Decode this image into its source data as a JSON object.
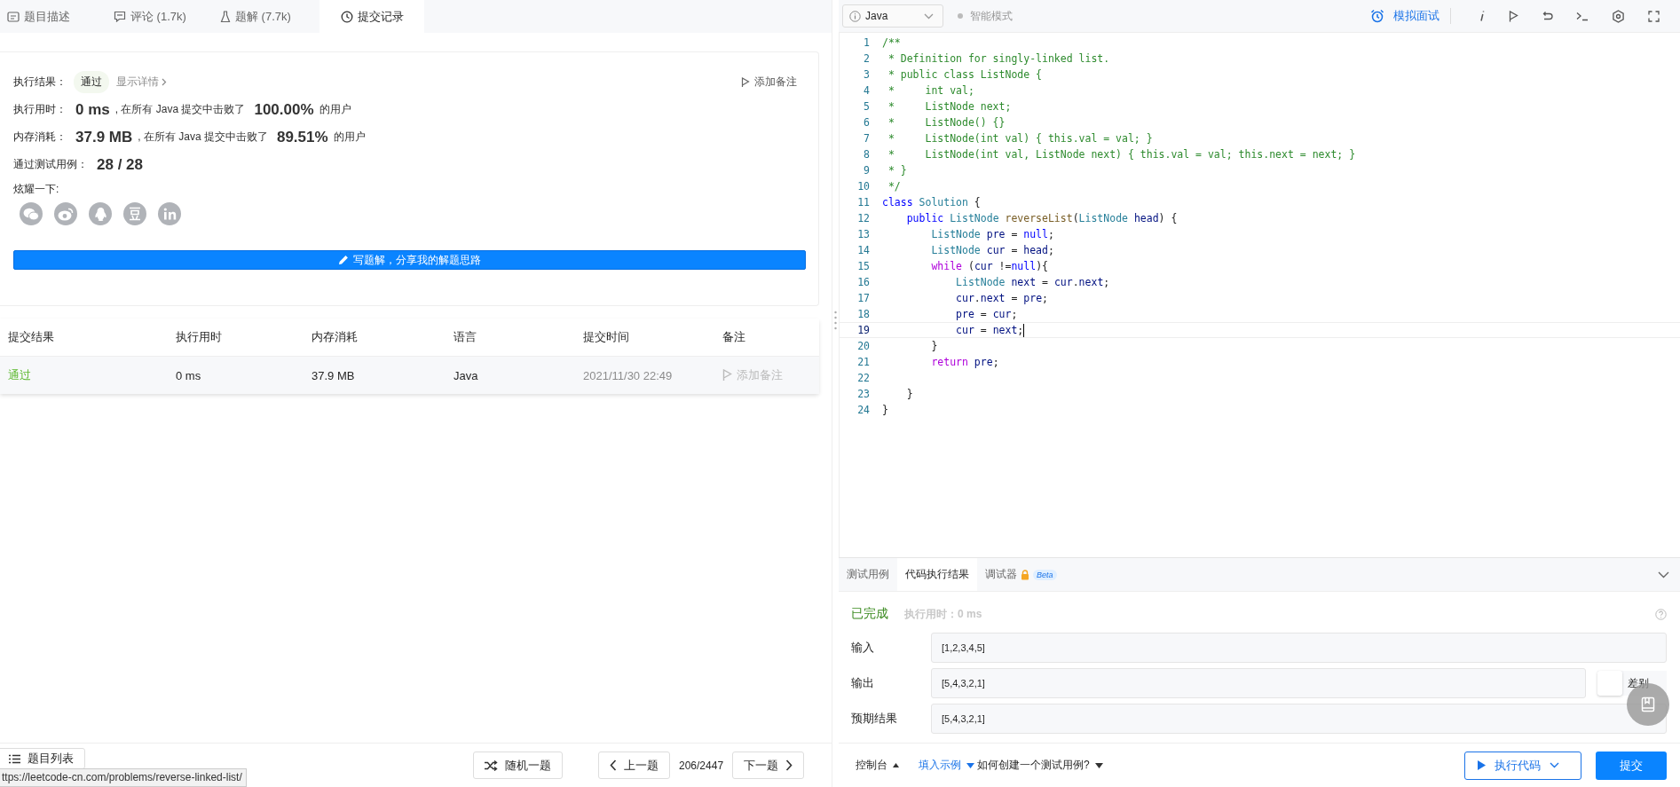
{
  "tabs": [
    {
      "label": "题目描述",
      "kind": "description",
      "selected": false
    },
    {
      "label": "评论 (1.7k)",
      "kind": "comments",
      "selected": false
    },
    {
      "label": "题解 (7.7k)",
      "kind": "solutions",
      "selected": false
    },
    {
      "label": "提交记录",
      "kind": "submissions",
      "selected": true
    }
  ],
  "result_card": {
    "status_label": "执行结果：",
    "status": "通过",
    "details_link": "显示详情",
    "add_note": "添加备注",
    "stats": [
      {
        "label": "执行用时：",
        "value": "0 ms",
        "text_before": ", 在所有 Java 提交中击败了",
        "percent": "100.00%",
        "text_after": "的用户"
      },
      {
        "label": "内存消耗：",
        "value": "37.9 MB",
        "text_before": ", 在所有 Java 提交中击败了",
        "percent": "89.51%",
        "text_after": "的用户"
      }
    ],
    "tests": {
      "label": "通过测试用例：",
      "value": "28 / 28"
    },
    "share_label": "炫耀一下:",
    "share": [
      {
        "kind": "wechat"
      },
      {
        "kind": "weibo"
      },
      {
        "kind": "qq"
      },
      {
        "kind": "douban"
      },
      {
        "kind": "linkedin"
      }
    ],
    "write_button": "写题解，分享我的解题思路"
  },
  "submissions": {
    "columns": [
      "提交结果",
      "执行用时",
      "内存消耗",
      "语言",
      "提交时间",
      "备注"
    ],
    "rows": [
      {
        "status": "通过",
        "runtime": "0 ms",
        "memory": "37.9 MB",
        "language": "Java",
        "time": "2021/11/30 22:49",
        "note": "添加备注"
      }
    ]
  },
  "editor": {
    "language": "Java",
    "mode": "智能模式",
    "mock_interview": "模拟面试",
    "lines": [
      {
        "number": "1",
        "current": false,
        "tokens": [
          {
            "kind": "comment",
            "t": "/**"
          }
        ]
      },
      {
        "number": "2",
        "current": false,
        "tokens": [
          {
            "kind": "comment",
            "t": " * Definition for singly-linked list."
          }
        ]
      },
      {
        "number": "3",
        "current": false,
        "tokens": [
          {
            "kind": "comment",
            "t": " * public class ListNode {"
          }
        ]
      },
      {
        "number": "4",
        "current": false,
        "tokens": [
          {
            "kind": "comment",
            "t": " *     int val;"
          }
        ]
      },
      {
        "number": "5",
        "current": false,
        "tokens": [
          {
            "kind": "comment",
            "t": " *     ListNode next;"
          }
        ]
      },
      {
        "number": "6",
        "current": false,
        "tokens": [
          {
            "kind": "comment",
            "t": " *     ListNode() {}"
          }
        ]
      },
      {
        "number": "7",
        "current": false,
        "tokens": [
          {
            "kind": "comment",
            "t": " *     ListNode(int val) { this.val = val; }"
          }
        ]
      },
      {
        "number": "8",
        "current": false,
        "tokens": [
          {
            "kind": "comment",
            "t": " *     ListNode(int val, ListNode next) { this.val = val; this.next = next; }"
          }
        ]
      },
      {
        "number": "9",
        "current": false,
        "tokens": [
          {
            "kind": "comment",
            "t": " * }"
          }
        ]
      },
      {
        "number": "10",
        "current": false,
        "tokens": [
          {
            "kind": "comment",
            "t": " */"
          }
        ]
      },
      {
        "number": "11",
        "current": false,
        "tokens": [
          {
            "kind": "keyword",
            "t": "class"
          },
          {
            "kind": "type",
            "t": " Solution"
          },
          {
            "kind": "text",
            "t": " {"
          }
        ]
      },
      {
        "number": "12",
        "current": false,
        "tokens": [
          {
            "kind": "keyword",
            "t": "    public"
          },
          {
            "kind": "type",
            "t": " ListNode"
          },
          {
            "kind": "function",
            "t": " reverseList"
          },
          {
            "kind": "text",
            "t": "("
          },
          {
            "kind": "type",
            "t": "ListNode"
          },
          {
            "kind": "variable",
            "t": " head"
          },
          {
            "kind": "text",
            "t": ") {"
          }
        ]
      },
      {
        "number": "13",
        "current": false,
        "tokens": [
          {
            "kind": "type",
            "t": "        ListNode"
          },
          {
            "kind": "variable",
            "t": " pre"
          },
          {
            "kind": "text",
            "t": " = "
          },
          {
            "kind": "keyword",
            "t": "null"
          },
          {
            "kind": "text",
            "t": ";"
          }
        ]
      },
      {
        "number": "14",
        "current": false,
        "tokens": [
          {
            "kind": "type",
            "t": "        ListNode"
          },
          {
            "kind": "variable",
            "t": " cur"
          },
          {
            "kind": "text",
            "t": " = "
          },
          {
            "kind": "variable",
            "t": "head"
          },
          {
            "kind": "text",
            "t": ";"
          }
        ]
      },
      {
        "number": "15",
        "current": false,
        "tokens": [
          {
            "kind": "control",
            "t": "        while"
          },
          {
            "kind": "text",
            "t": " ("
          },
          {
            "kind": "variable",
            "t": "cur"
          },
          {
            "kind": "text",
            "t": " !="
          },
          {
            "kind": "keyword",
            "t": "null"
          },
          {
            "kind": "text",
            "t": "){"
          }
        ]
      },
      {
        "number": "16",
        "current": false,
        "tokens": [
          {
            "kind": "type",
            "t": "            ListNode"
          },
          {
            "kind": "variable",
            "t": " next"
          },
          {
            "kind": "text",
            "t": " = "
          },
          {
            "kind": "variable",
            "t": "cur"
          },
          {
            "kind": "text",
            "t": "."
          },
          {
            "kind": "variable",
            "t": "next"
          },
          {
            "kind": "text",
            "t": ";"
          }
        ]
      },
      {
        "number": "17",
        "current": false,
        "tokens": [
          {
            "kind": "variable",
            "t": "            cur"
          },
          {
            "kind": "text",
            "t": "."
          },
          {
            "kind": "variable",
            "t": "next"
          },
          {
            "kind": "text",
            "t": " = "
          },
          {
            "kind": "variable",
            "t": "pre"
          },
          {
            "kind": "text",
            "t": ";"
          }
        ]
      },
      {
        "number": "18",
        "current": false,
        "tokens": [
          {
            "kind": "variable",
            "t": "            pre"
          },
          {
            "kind": "text",
            "t": " = "
          },
          {
            "kind": "variable",
            "t": "cur"
          },
          {
            "kind": "text",
            "t": ";"
          }
        ]
      },
      {
        "number": "19",
        "current": true,
        "tokens": [
          {
            "kind": "variable",
            "t": "            cur"
          },
          {
            "kind": "text",
            "t": " = "
          },
          {
            "kind": "variable",
            "t": "next"
          },
          {
            "kind": "text",
            "t": ";"
          }
        ]
      },
      {
        "number": "20",
        "current": false,
        "tokens": [
          {
            "kind": "text",
            "t": "        }"
          }
        ]
      },
      {
        "number": "21",
        "current": false,
        "tokens": [
          {
            "kind": "control",
            "t": "        return"
          },
          {
            "kind": "variable",
            "t": " pre"
          },
          {
            "kind": "text",
            "t": ";"
          }
        ]
      },
      {
        "number": "22",
        "current": false
      },
      {
        "number": "23",
        "current": false,
        "tokens": [
          {
            "kind": "text",
            "t": "    }"
          }
        ]
      },
      {
        "number": "24",
        "current": false,
        "tokens": [
          {
            "kind": "text",
            "t": "}"
          }
        ]
      }
    ]
  },
  "console": {
    "tabs": [
      {
        "label": "测试用例",
        "selected": false,
        "locked": false
      },
      {
        "label": "代码执行结果",
        "selected": true,
        "locked": false
      },
      {
        "label": "调试器",
        "selected": false,
        "locked": true,
        "badge": "Beta"
      }
    ],
    "status": "已完成",
    "runtime": "执行用时：0 ms",
    "fields": [
      {
        "label": "输入",
        "value": "[1,2,3,4,5]"
      },
      {
        "label": "输出",
        "value": "[5,4,3,2,1]",
        "diff_button": "差别"
      },
      {
        "label": "预期结果",
        "value": "[5,4,3,2,1]"
      }
    ]
  },
  "footer": {
    "problem_list": "题目列表",
    "random": "随机一题",
    "prev": "上一题",
    "counter": "206/2447",
    "next": "下一题",
    "console": "控制台",
    "fill_example": "填入示例",
    "how_to": "如何创建一个测试用例?",
    "run": "执行代码",
    "submit": "提交"
  },
  "status_url": "ttps://leetcode-cn.com/problems/reverse-linked-list/"
}
